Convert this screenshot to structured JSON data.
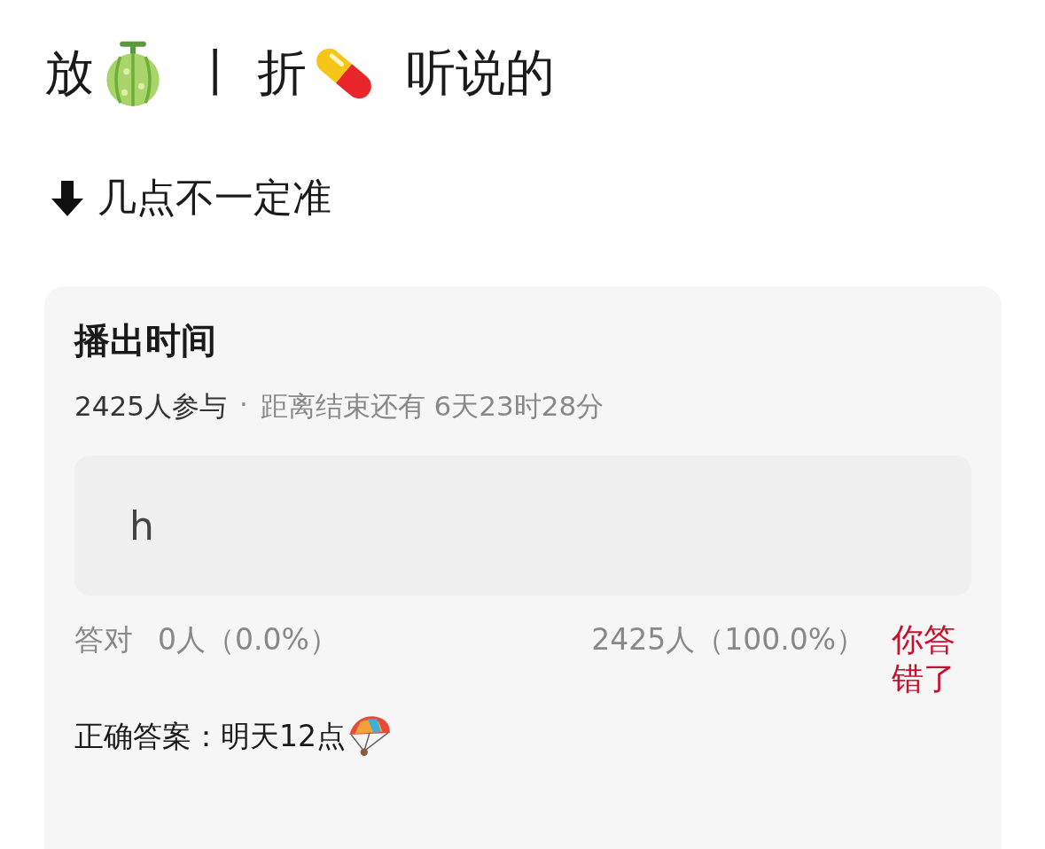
{
  "headline": [
    {
      "kind": "text",
      "text": "放"
    },
    {
      "kind": "melon"
    },
    {
      "kind": "text",
      "text": "丨 折"
    },
    {
      "kind": "pill"
    },
    {
      "kind": "text",
      "text": "听说的"
    }
  ],
  "note": {
    "text": "几点不一定准"
  },
  "poll": {
    "title": "播出时间",
    "participants": "2425人参与",
    "separator": "·",
    "countdown": "距离结束还有 6天23时28分",
    "answer": "h",
    "correct_label": "答对",
    "correct_count": "0人（0.0%）",
    "answer_count": "2425人（100.0%）",
    "result": {
      "text": "你答错了",
      "correct": false
    },
    "solution": "正确答案：明天12点"
  }
}
